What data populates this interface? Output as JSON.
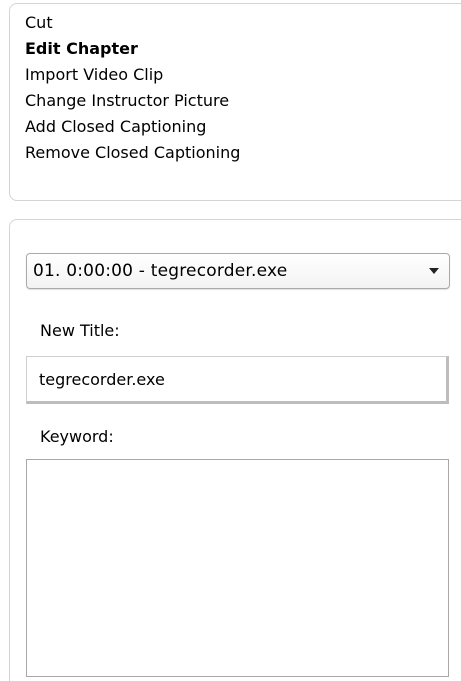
{
  "menu": {
    "items": [
      {
        "label": "Cut",
        "active": false
      },
      {
        "label": "Edit Chapter",
        "active": true
      },
      {
        "label": "Import Video Clip",
        "active": false
      },
      {
        "label": "Change Instructor Picture",
        "active": false
      },
      {
        "label": "Add Closed Captioning",
        "active": false
      },
      {
        "label": "Remove Closed Captioning",
        "active": false
      }
    ]
  },
  "edit_chapter": {
    "chapter_select": {
      "selected": "01. 0:00:00 - tegrecorder.exe"
    },
    "new_title_label": "New Title:",
    "new_title_value": "tegrecorder.exe",
    "keyword_label": "Keyword:",
    "keyword_value": ""
  }
}
